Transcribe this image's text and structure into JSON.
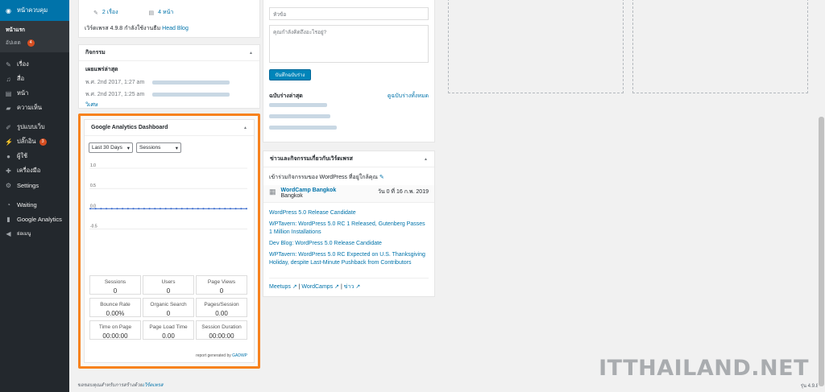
{
  "sidebar": {
    "active": "หน้าควบคุม",
    "sub_items": [
      {
        "label": "หน้าแรก"
      },
      {
        "label": "อัปเดต",
        "badge": "4"
      }
    ],
    "items": [
      {
        "label": "เรื่อง",
        "icon": "pin-icon"
      },
      {
        "label": "สื่อ",
        "icon": "media-icon"
      },
      {
        "label": "หน้า",
        "icon": "page-icon"
      },
      {
        "label": "ความเห็น",
        "icon": "comment-icon"
      },
      {
        "label": "รูปแบบเว็บ",
        "icon": "brush-icon"
      },
      {
        "label": "ปลั๊กอิน",
        "icon": "plugin-icon",
        "badge": "3"
      },
      {
        "label": "ผู้ใช้",
        "icon": "user-icon"
      },
      {
        "label": "เครื่องมือ",
        "icon": "wrench-icon"
      },
      {
        "label": "Settings",
        "icon": "settings-icon"
      },
      {
        "label": "Waiting",
        "icon": "clock-icon"
      },
      {
        "label": "Google Analytics",
        "icon": "chart-icon"
      },
      {
        "label": "ย่อเมนู",
        "icon": "collapse-icon"
      }
    ]
  },
  "glance": {
    "posts": "2 เรื่อง",
    "pages": "4 หน้า",
    "footer_prefix": "เวิร์ดเพรส 4.9.8 กำลังใช้งานธีม",
    "theme": "Head Blog"
  },
  "activity": {
    "title": "กิจกรรม",
    "subtitle": "เผยแพร่ล่าสุด",
    "rows": [
      {
        "date": "พ.ศ. 2nd 2017, 1:27 am"
      },
      {
        "date": "พ.ศ. 2nd 2017, 1:25 am"
      }
    ],
    "more": "วิเศษ"
  },
  "ga": {
    "title": "Google Analytics Dashboard",
    "period": "Last 30 Days",
    "metric": "Sessions",
    "ticks": [
      "1.0",
      "0.5",
      "0.0",
      "-0.5"
    ],
    "stats": [
      {
        "label": "Sessions",
        "value": "0"
      },
      {
        "label": "Users",
        "value": "0"
      },
      {
        "label": "Page Views",
        "value": "0"
      },
      {
        "label": "Bounce Rate",
        "value": "0.00%"
      },
      {
        "label": "Organic Search",
        "value": "0"
      },
      {
        "label": "Pages/Session",
        "value": "0.00"
      },
      {
        "label": "Time on Page",
        "value": "00:00:00"
      },
      {
        "label": "Page Load Time",
        "value": "0.00"
      },
      {
        "label": "Session Duration",
        "value": "00:00:00"
      }
    ],
    "report_prefix": "report generated by",
    "report_brand": "GADWP"
  },
  "chart_data": {
    "type": "line",
    "title": "",
    "series": [
      {
        "values": [
          0,
          0,
          0,
          0,
          0,
          0,
          0,
          0,
          0,
          0,
          0,
          0,
          0,
          0,
          0,
          0,
          0,
          0,
          0,
          0,
          0,
          0,
          0,
          0,
          0,
          0,
          0,
          0,
          0,
          0
        ]
      }
    ],
    "ylim": [
      -0.75,
      1.0
    ],
    "yticks": [
      1.0,
      0.5,
      0.0,
      -0.5
    ],
    "grid": true,
    "color": "#3366cc"
  },
  "draft": {
    "title_placeholder": "หัวข้อ",
    "content_placeholder": "คุณกำลังคิดถึงอะไรอยู่?",
    "save": "บันทึกฉบับร่าง",
    "recent": "ฉบับร่างล่าสุด",
    "view_all": "ดูฉบับร่างทั้งหมด"
  },
  "news": {
    "title": "ข่าวและกิจกรรมเกี่ยวกับเวิร์ดเพรส",
    "intro": "เข้าร่วมกิจกรรมของ WordPress ที่อยู่ใกล้คุณ",
    "event": {
      "name": "WordCamp Bangkok",
      "place": "Bangkok",
      "date": "วัน 0 ที่ 16 ก.พ. 2019"
    },
    "items": [
      "WordPress 5.0 Release Candidate",
      "WPTavern: WordPress 5.0 RC 1 Released, Gutenberg Passes 1 Million Installations",
      "Dev Blog: WordPress 5.0 Release Candidate",
      "WPTavern: WordPress 5.0 RC Expected on U.S. Thanksgiving Holiday, despite Last-Minute Pushback from Contributors"
    ],
    "links": [
      "Meetups",
      "WordCamps",
      "ข่าว"
    ]
  },
  "footer": {
    "prefix": "ขอขอบคุณสำหรับการสร้างด้วย",
    "link": "เวิร์ดเพรส",
    "version": "รุ่น 4.9.8"
  },
  "watermark": "ITTHAILAND.NET",
  "colors": {
    "accent": "#0073aa",
    "highlight": "#f7821d",
    "sidebar": "#23282d"
  }
}
